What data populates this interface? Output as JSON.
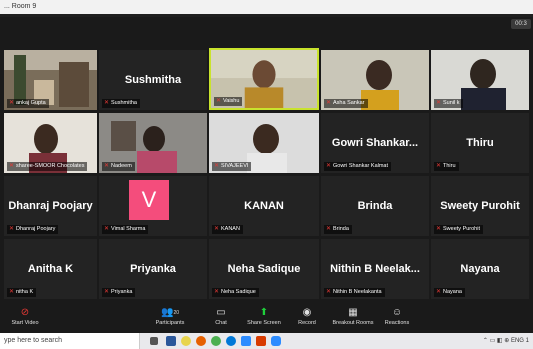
{
  "window": {
    "title": "... Room 9",
    "timer": "00:3"
  },
  "tiles": [
    {
      "id": "t1",
      "label": "ankaj Gupta",
      "big": "",
      "video": true
    },
    {
      "id": "t2",
      "label": "Sushmitha",
      "big": "Sushmitha",
      "video": false
    },
    {
      "id": "t3",
      "label": "Vaishu",
      "big": "",
      "video": true,
      "active": true
    },
    {
      "id": "t4",
      "label": "Asha Sankar",
      "big": "",
      "video": true
    },
    {
      "id": "t5",
      "label": "Sunil k",
      "big": "",
      "video": true
    },
    {
      "id": "t6",
      "label": "sharee-SMOOR Chocolates",
      "big": "",
      "video": true
    },
    {
      "id": "t7",
      "label": "Nadeem",
      "big": "",
      "video": true
    },
    {
      "id": "t8",
      "label": "SIVAJEEVI",
      "big": "",
      "video": true
    },
    {
      "id": "t9",
      "label": "Gowri Shankar Kalmat",
      "big": "Gowri  Shankar...",
      "video": false
    },
    {
      "id": "t10",
      "label": "Thiru",
      "big": "Thiru",
      "video": false
    },
    {
      "id": "t11",
      "label": "Dhanraj Poojary",
      "big": "Dhanraj Poojary",
      "video": false
    },
    {
      "id": "t12",
      "label": "Vimal Sharma",
      "big": "V",
      "video": false,
      "avatar": true
    },
    {
      "id": "t13",
      "label": "KANAN",
      "big": "KANAN",
      "video": false
    },
    {
      "id": "t14",
      "label": "Brinda",
      "big": "Brinda",
      "video": false
    },
    {
      "id": "t15",
      "label": "Sweety Purohit",
      "big": "Sweety Purohit",
      "video": false
    },
    {
      "id": "t16",
      "label": "nitha K",
      "big": "Anitha K",
      "video": false
    },
    {
      "id": "t17",
      "label": "Priyanka",
      "big": "Priyanka",
      "video": false
    },
    {
      "id": "t18",
      "label": "Neha Sadique",
      "big": "Neha Sadique",
      "video": false
    },
    {
      "id": "t19",
      "label": "Nithin B Neelakanta",
      "big": "Nithin B Neelak...",
      "video": false
    },
    {
      "id": "t20",
      "label": "Nayana",
      "big": "Nayana",
      "video": false
    }
  ],
  "controls": {
    "start_video": "Start Video",
    "participants": "Participants",
    "participants_count": "20",
    "chat": "Chat",
    "share_screen": "Share Screen",
    "record": "Record",
    "breakout_rooms": "Breakout Rooms",
    "reactions": "Reactions"
  },
  "taskbar": {
    "search_placeholder": "ype here to search",
    "lang": "ENG",
    "time": "1"
  },
  "colors": {
    "active_border": "#c9e32d",
    "share_green": "#1fcf3b",
    "avatar_pink": "#f44d7c",
    "mic_red": "#e53935"
  }
}
